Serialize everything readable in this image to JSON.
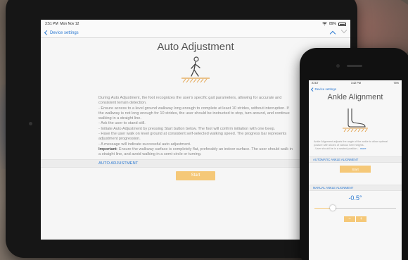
{
  "ipad": {
    "status": {
      "time": "3:51 PM",
      "date": "Mon Nov 12",
      "battery": "89%"
    },
    "nav": {
      "back_label": "Device settings"
    },
    "title": "Auto Adjustment",
    "description": [
      "During Auto Adjustment, the foot recognizes the user's specific gait parameters, allowing for accurate and consistent terrain detection.",
      "- Ensure access to a level ground walkway long enough to complete at least 10 strides, without interruption. If the walkway is not long enough for 10 strides, the user should be instructed to stop, turn around, and continue walking in a straight line.",
      "- Ask the user to stand still.",
      "- Initiate Auto Adjustment by pressing Start button below. The foot will confirm initiation with one beep.",
      "- Have the user walk on level ground at consistent self-selected walking speed. The progress bar represents adjustment progression.",
      "- A message will indicate successful auto adjustment."
    ],
    "important_label": "Important",
    "important_text": ": Ensure the walkway surface is completely flat, preferably an indoor surface. The user should walk in a straight line, and avoid walking in a semi-circle or turning.",
    "section_header": "AUTO ADJUSTMENT",
    "start_button": "Start"
  },
  "iphone": {
    "status": {
      "carrier": "AT&T",
      "time": "3:42 PM",
      "battery": "75%"
    },
    "nav": {
      "back_label": "Device settings"
    },
    "title": "Ankle Alignment",
    "description": "Ankle Alignment adjusts the angle of the ankle to allow optimal posture with shoes of various heel heights.",
    "description_more": "- User should be in a seated position...",
    "more_link": "more",
    "auto_section": "AUTOMATIC ANKLE ALIGNMENT",
    "start_button": "Start",
    "manual_section": "MANUAL ANKLE ALIGNMENT",
    "value": "-0.5°",
    "slider_position": 0.22,
    "minus_label": "−",
    "plus_label": "+"
  },
  "icons": [
    "back-chevron-icon",
    "up-arrow-icon",
    "down-arrow-icon",
    "walking-person-icon",
    "foot-ankle-icon",
    "wifi-icon",
    "battery-icon"
  ],
  "colors": {
    "accent": "#2a78d1",
    "button": "#f5c878",
    "text": "#888888"
  }
}
